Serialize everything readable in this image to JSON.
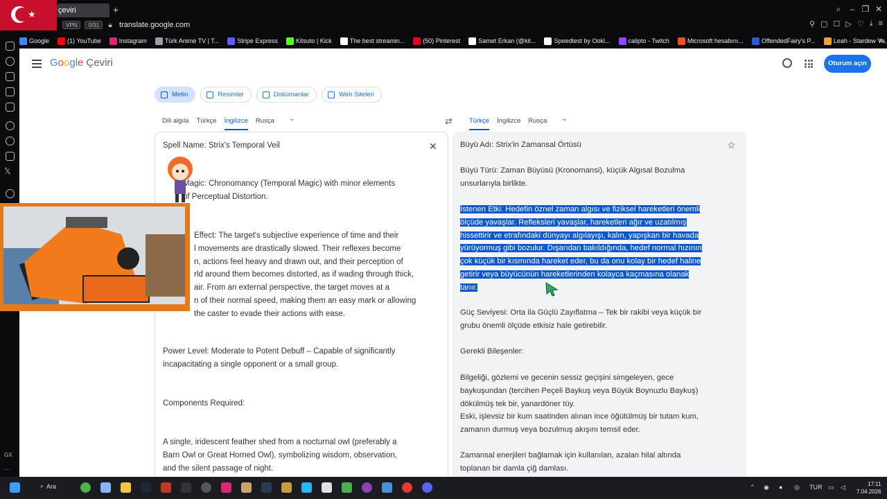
{
  "browser": {
    "tab_title": "çeviri",
    "new_tab_label": "+",
    "vpn_label": "VPN",
    "vpn_count": "0/31",
    "url": "translate.google.com",
    "bookmarks": [
      {
        "label": "Google",
        "color": "#4285f4"
      },
      {
        "label": "(1) YouTube",
        "color": "#ff0000"
      },
      {
        "label": "Instagram",
        "color": "#d62976"
      },
      {
        "label": "Türk Anime TV | T...",
        "color": "#9aa0a6"
      },
      {
        "label": "Stripe Express",
        "color": "#635bff"
      },
      {
        "label": "Kitsuto | Kick",
        "color": "#53fc18"
      },
      {
        "label": "The best streamin...",
        "color": "#ffffff"
      },
      {
        "label": "(50) Pinterest",
        "color": "#e60023"
      },
      {
        "label": "Samet Erkan (@kit...",
        "color": "#ffffff"
      },
      {
        "label": "Speedtest by Ookl...",
        "color": "#ffffff"
      },
      {
        "label": "calipto - Twitch",
        "color": "#9146ff"
      },
      {
        "label": "Microsoft hesabını...",
        "color": "#f25022"
      },
      {
        "label": "OffendedFairy's P...",
        "color": "#2b5bd7"
      },
      {
        "label": "Leah - Stardew Va...",
        "color": "#e8a33d"
      }
    ],
    "sidebar_bottom_label": "GX"
  },
  "header": {
    "logo_letters": [
      "G",
      "o",
      "o",
      "g",
      "l",
      "e"
    ],
    "product": "Çeviri",
    "signin_label": "Oturum açın"
  },
  "modes": [
    {
      "label": "Metin",
      "active": true
    },
    {
      "label": "Resimler",
      "active": false
    },
    {
      "label": "Dokümanlar",
      "active": false
    },
    {
      "label": "Web Siteleri",
      "active": false
    }
  ],
  "source_langs": [
    {
      "label": "Dili algıla",
      "active": false
    },
    {
      "label": "Türkçe",
      "active": false
    },
    {
      "label": "İngilizce",
      "active": true
    },
    {
      "label": "Rusça",
      "active": false
    }
  ],
  "target_langs": [
    {
      "label": "Türkçe",
      "active": true
    },
    {
      "label": "İngilizce",
      "active": false
    },
    {
      "label": "Rusça",
      "active": false
    }
  ],
  "source": {
    "paragraphs": [
      "Spell Name: Strix's Temporal Veil",
      "Magic: Chronomancy (Temporal Magic) with minor elements\nof Perceptual Distortion.",
      "Effect: The target's subjective experience of time and their\nl movements are drastically slowed. Their reflexes become\nn, actions feel heavy and drawn out, and their perception of\nrld around them becomes distorted, as if wading through thick,\nair. From an external perspective, the target moves at a\nn of their normal speed, making them an easy mark or allowing\nthe caster to evade their actions with ease.",
      "Power Level: Moderate to Potent Debuff – Capable of significantly\nincapacitating a single opponent or a small group.",
      "Components Required:",
      "A single, iridescent feather shed from a nocturnal owl (preferably a\nBarn Owl or Great Horned Owl), symbolizing wisdom, observation,\nand the silent passage of night."
    ]
  },
  "target": {
    "paragraphs": [
      "Büyü Adı: Strix'in Zamansal Örtüsü",
      "Büyü Türü: Zaman Büyüsü (Kronomansi), küçük Algısal Bozulma\nunsurlarıyla birlikte.",
      "Güç Seviyesi: Orta ila Güçlü Zayıflatma – Tek bir rakibi veya küçük bir\ngrubu önemli ölçüde etkisiz hale getirebilir.",
      "Gerekli Bileşenler:",
      "Bilgeliği, gözlemi ve gecenin sessiz geçişini simgeleyen, gece\nbaykuşundan (tercihen Peçeli Baykuş veya Büyük Boynuzlu Baykuş)\ndökülmüş tek bir, yanardöner tüy.\nEski, işlevsiz bir kum saatinden alınan ince öğütülmüş bir tutam kum,\nzamanın durmuş veya bozulmuş akışını temsil eder.",
      "Zamansal enerjileri bağlamak için kullanılan, azalan hilal altında\ntoplanan bir damla çiğ damlası."
    ],
    "highlighted_lines": [
      "İstenen Etki: Hedefin öznel zaman algısı ve fiziksel hareketleri önemli",
      "ölçüde yavaşlar. Refleksleri yavaşlar, hareketleri ağır ve uzatılmış",
      "hissettirir ve etrafındaki dünyayı algılayışı, kalın, yapışkan bir havada",
      "yürüyormuş gibi bozulur. Dışarıdan bakıldığında, hedef normal hızının",
      "çok küçük bir kısmında hareket eder, bu da onu kolay bir hedef haline",
      "getirir veya büyücünün hareketlerinden kolayca kaçmasına olanak",
      "tanır."
    ]
  },
  "taskbar": {
    "search_label": "Ara",
    "language": "TUR",
    "time": "17:11",
    "date": "7.04.2026"
  }
}
